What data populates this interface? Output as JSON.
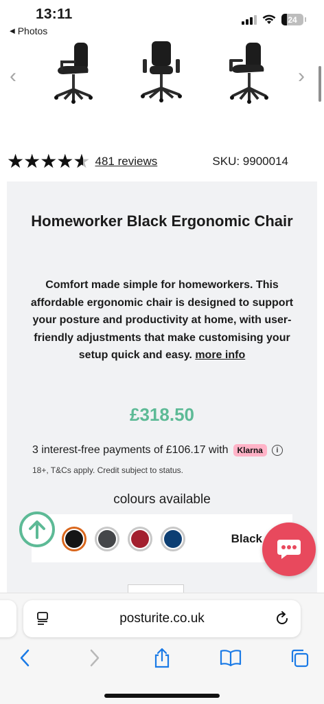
{
  "status_bar": {
    "time": "13:11",
    "back_label": "Photos",
    "battery": "24",
    "battery_level": 0.24
  },
  "product": {
    "title": "Homeworker Black Ergonomic Chair",
    "rating_stars": 4.6,
    "reviews_label": "481 reviews",
    "sku": "SKU: 9900014",
    "description": "Comfort made simple for homeworkers. This affordable ergonomic chair is designed to support your posture and productivity at home, with user-friendly adjustments that make customising your setup quick and easy.",
    "more_info_label": "more info",
    "price": "£318.50",
    "installment_text": "3 interest-free payments of £106.17 with",
    "klarna_label": "Klarna",
    "terms_text": "18+, T&Cs apply. Credit subject to status.",
    "colours_label": "colours available",
    "selected_colour": "Black",
    "swatches": [
      {
        "name": "Black",
        "color": "#151515",
        "selected": true
      },
      {
        "name": "Grey",
        "color": "#45474a",
        "selected": false
      },
      {
        "name": "Red",
        "color": "#a3202f",
        "selected": false
      },
      {
        "name": "Blue",
        "color": "#0d3f73",
        "selected": false
      }
    ]
  },
  "colors": {
    "price_green": "#5dba96",
    "chat_red": "#e8495d",
    "klarna_pink": "#ffb3c7",
    "safari_blue": "#1a7ae6"
  },
  "browser": {
    "url": "posturite.co.uk"
  },
  "icons": [
    "chevron-left-icon",
    "chevron-right-icon",
    "star-icon",
    "info-icon",
    "arrow-up-icon",
    "chat-icon",
    "reader-icon",
    "reload-icon",
    "back-icon",
    "forward-icon",
    "share-icon",
    "bookmarks-icon",
    "tabs-icon"
  ]
}
